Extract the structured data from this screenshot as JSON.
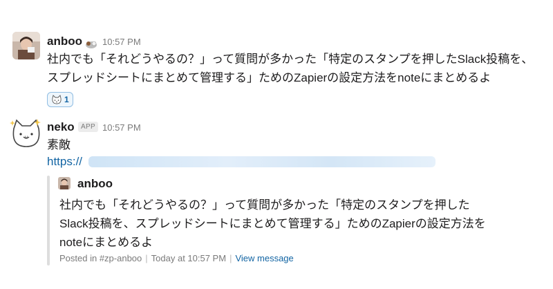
{
  "messages": [
    {
      "user": "anboo",
      "time": "10:57 PM",
      "lines": [
        "社内でも「それどうやるの？」って質問が多かった「特定のスタンプを押したSlack投稿を、",
        "スプレッドシートにまとめて管理する」ためのZapierの設定方法をnoteにまとめるよ"
      ],
      "reaction": {
        "icon": "cat-face-emoji",
        "count": "1"
      }
    },
    {
      "user": "neko",
      "badge": "APP",
      "time": "10:57 PM",
      "text": "素敵",
      "link": "https://"
    }
  ],
  "attachment": {
    "author": "anboo",
    "lines": [
      "社内でも「それどうやるの？」って質問が多かった「特定のスタンプを押した",
      "Slack投稿を、スプレッドシートにまとめて管理する」ためのZapierの設定方法を",
      "noteにまとめるよ"
    ],
    "footer": {
      "posted_in": "Posted in #zp-anboo",
      "timestamp": "Today at 10:57 PM",
      "view": "View message"
    }
  },
  "colors": {
    "link": "#1264a3",
    "reaction_border": "#8fbde3",
    "reaction_bg": "#eef6fc"
  }
}
